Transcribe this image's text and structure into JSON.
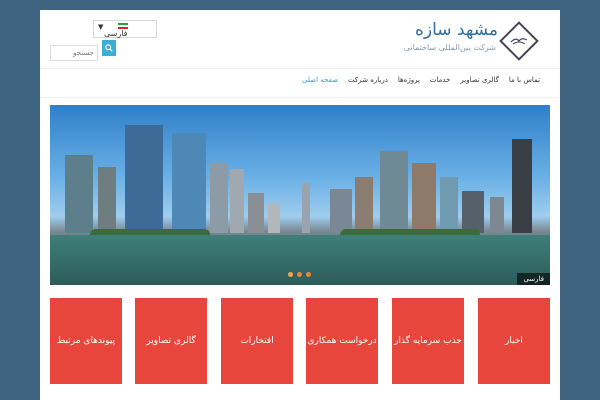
{
  "header": {
    "logo_title": "مشهد سازه",
    "logo_subtitle": "شرکت بین‌المللی ساختمانی",
    "logo_icon": "diamond-bird-icon",
    "language": {
      "selected": "فارسی",
      "flag": "iran-flag-icon"
    },
    "search": {
      "placeholder": "جستجو",
      "icon": "search-icon"
    }
  },
  "nav": {
    "items": [
      {
        "label": "صفحه اصلی",
        "active": true
      },
      {
        "label": "درباره شرکت",
        "active": false
      },
      {
        "label": "پروژه‌ها",
        "active": false
      },
      {
        "label": "خدمات",
        "active": false
      },
      {
        "label": "گالری تصاویر",
        "active": false
      },
      {
        "label": "تماس با ما",
        "active": false
      }
    ]
  },
  "slider": {
    "caption": "فارسی",
    "dots": 3,
    "active_dot": 1
  },
  "tiles": [
    {
      "label": "اخبار"
    },
    {
      "label": "جذب سرمایه گذار"
    },
    {
      "label": "درخواست همکاری"
    },
    {
      "label": "افتخارات"
    },
    {
      "label": "گالری تصاویر"
    },
    {
      "label": "پیوندهای مرتبط"
    }
  ],
  "colors": {
    "background": "#3e6482",
    "accent_blue": "#2d6fa3",
    "nav_active": "#2aa0d8",
    "tile_red": "#e8463c"
  }
}
